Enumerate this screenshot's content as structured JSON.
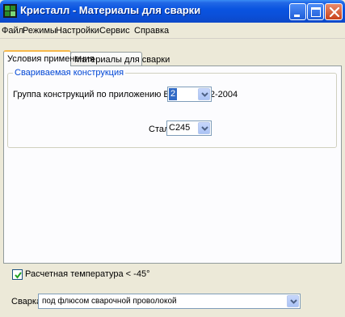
{
  "window": {
    "title": "Кристалл - Материалы для сварки",
    "colors": {
      "titlebar": "#0b4fd8",
      "accent": "#316ac5",
      "legend": "#0046d5"
    }
  },
  "menu": {
    "items": [
      "Файл",
      "Режимы",
      "Настройки",
      "Сервис",
      "Справка"
    ]
  },
  "tabs": {
    "conditions": "Условия применения",
    "materials": "Материалы для сварки"
  },
  "welded_structure": {
    "legend": "Свариваемая конструкция",
    "group_label": "Группа конструкций по приложению В СП 53-102-2004",
    "group_value": "2",
    "steel_label": "Сталь",
    "steel_value": "С245"
  },
  "temperature_checkbox": {
    "label": "Расчетная температура < -45°",
    "checked": true
  },
  "welding": {
    "label": "Сварка",
    "value": "под флюсом  сварочной  проволокой"
  }
}
